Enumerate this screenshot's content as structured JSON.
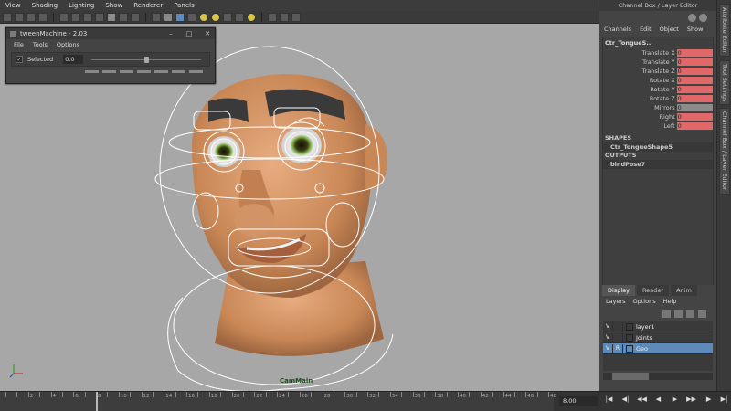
{
  "viewport": {
    "menus": [
      "View",
      "Shading",
      "Lighting",
      "Show",
      "Renderer",
      "Panels"
    ],
    "camera_label": "CamMain",
    "axis_labels": [
      "Y",
      "Z",
      "X"
    ]
  },
  "tween_machine": {
    "title": "tweenMachine - 2.03",
    "menus": [
      "File",
      "Tools",
      "Options"
    ],
    "selected_label": "Selected",
    "selected_checked": true,
    "value": "0.0",
    "slider_position": 0.5
  },
  "channel_box": {
    "header": "Channel Box / Layer Editor",
    "menus": [
      "Channels",
      "Edit",
      "Object",
      "Show"
    ],
    "object_name": "Ctr_TongueS...",
    "attributes": [
      {
        "name": "Translate X",
        "value": "0"
      },
      {
        "name": "Translate Y",
        "value": "0"
      },
      {
        "name": "Translate Z",
        "value": "0"
      },
      {
        "name": "Rotate X",
        "value": "0"
      },
      {
        "name": "Rotate Y",
        "value": "0"
      },
      {
        "name": "Rotate Z",
        "value": "0"
      },
      {
        "name": "Mirrors",
        "value": "0"
      },
      {
        "name": "Right",
        "value": "0"
      },
      {
        "name": "Left",
        "value": "0"
      }
    ],
    "shapes_label": "SHAPES",
    "shape_name": "Ctr_TongueShape5",
    "outputs_label": "OUTPUTS",
    "output_name": "bindPose7",
    "attr_color": "#e06868",
    "attr_gray_color": "#8c8c8c"
  },
  "side_tabs": [
    "Attribute Editor",
    "Tool Settings",
    "Channel Box / Layer Editor"
  ],
  "layer_editor": {
    "tabs": [
      "Display",
      "Render",
      "Anim"
    ],
    "active_tab": "Display",
    "menus": [
      "Layers",
      "Options",
      "Help"
    ],
    "layers": [
      {
        "visible": "V",
        "ref": "",
        "name": "layer1",
        "selected": false
      },
      {
        "visible": "V",
        "ref": "",
        "name": "Joints",
        "selected": false
      },
      {
        "visible": "V",
        "ref": "R",
        "name": "Geo",
        "selected": true
      }
    ],
    "selection_color": "#5d8ab8"
  },
  "timeline": {
    "tick_labels": [
      "2",
      "4",
      "6",
      "8",
      "10",
      "12",
      "14",
      "16",
      "18",
      "20",
      "22",
      "24",
      "26",
      "28",
      "30",
      "32",
      "34",
      "36",
      "38",
      "40",
      "42",
      "44",
      "46",
      "48"
    ],
    "current_frame": "8.00",
    "playback_icons": [
      "go-to-start-icon",
      "step-back-key-icon",
      "step-back-frame-icon",
      "play-back-icon",
      "play-forward-icon",
      "step-forward-frame-icon",
      "step-forward-key-icon",
      "go-to-end-icon"
    ],
    "playback_glyphs": [
      "|◀",
      "◀|",
      "◀◀",
      "◀",
      "▶",
      "▶▶",
      "|▶",
      "▶|"
    ]
  }
}
